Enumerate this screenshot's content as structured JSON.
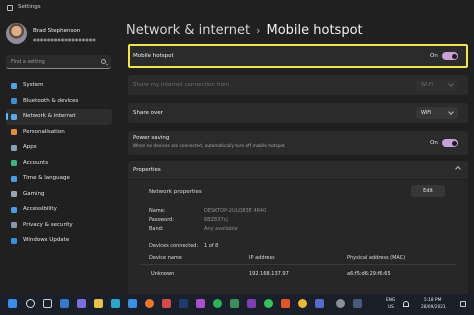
{
  "window": {
    "title": "Settings"
  },
  "user": {
    "name": "Brad Stephenson",
    "email": "●●●●●●●●●●●●●●●●●●"
  },
  "search": {
    "placeholder": "Find a setting"
  },
  "nav": [
    {
      "label": "System",
      "icon": "monitor-icon",
      "color": "#4aa3df"
    },
    {
      "label": "Bluetooth & devices",
      "icon": "bluetooth-icon",
      "color": "#3f8fd6"
    },
    {
      "label": "Network & internet",
      "icon": "wifi-icon",
      "color": "#5aa9e6",
      "active": true
    },
    {
      "label": "Personalisation",
      "icon": "brush-icon",
      "color": "#e58b3a"
    },
    {
      "label": "Apps",
      "icon": "apps-icon",
      "color": "#8aa0b8"
    },
    {
      "label": "Accounts",
      "icon": "person-icon",
      "color": "#3fb27f"
    },
    {
      "label": "Time & language",
      "icon": "globe-clock-icon",
      "color": "#4a9be0"
    },
    {
      "label": "Gaming",
      "icon": "gamepad-icon",
      "color": "#9aa4b0"
    },
    {
      "label": "Accessibility",
      "icon": "accessibility-icon",
      "color": "#4a9be0"
    },
    {
      "label": "Privacy & security",
      "icon": "shield-icon",
      "color": "#8a96a6"
    },
    {
      "label": "Windows Update",
      "icon": "update-icon",
      "color": "#3a8ee0"
    }
  ],
  "breadcrumb": {
    "parent": "Network & internet",
    "separator": "›",
    "current": "Mobile hotspot"
  },
  "hotspot": {
    "label": "Mobile hotspot",
    "state": "On"
  },
  "share_from": {
    "label": "Share my Internet connection from",
    "value": "Wi-Fi"
  },
  "share_over": {
    "label": "Share over",
    "value": "WiFi"
  },
  "power_saving": {
    "label": "Power saving",
    "description": "When no devices are connected, automatically turn off mobile hotspot",
    "state": "On"
  },
  "properties": {
    "title": "Properties",
    "network_properties": "Network properties",
    "edit_label": "Edit",
    "fields": [
      {
        "key": "Name:",
        "value": "DESKTOP-2ULQ83E 4640"
      },
      {
        "key": "Password:",
        "value": "6BZ837cj"
      },
      {
        "key": "Band:",
        "value": "Any available"
      }
    ],
    "devices_connected_label": "Devices connected:",
    "devices_connected_value": "1 of 8",
    "table": {
      "headers": [
        "Device name",
        "IP address",
        "Physical address (MAC)"
      ],
      "rows": [
        [
          "Unknown",
          "192.168.137.97",
          "a6:f5:d6:29:f6:65"
        ]
      ]
    }
  },
  "taskbar": {
    "apps": [
      "start-icon",
      "search-icon",
      "task-view-icon",
      "widgets-icon",
      "chat-icon",
      "explorer-icon",
      "edge-icon",
      "store-icon",
      "firefox-icon",
      "app-icon",
      "photoshop-icon",
      "teams-icon",
      "spotify-icon",
      "app-icon",
      "onenote-icon",
      "whatsapp-icon",
      "brave-icon",
      "chrome-icon",
      "app-icon",
      "settings-icon",
      "app-icon"
    ],
    "language": "ENG",
    "region": "US",
    "time": "5:18 PM",
    "date": "28/09/2021"
  }
}
